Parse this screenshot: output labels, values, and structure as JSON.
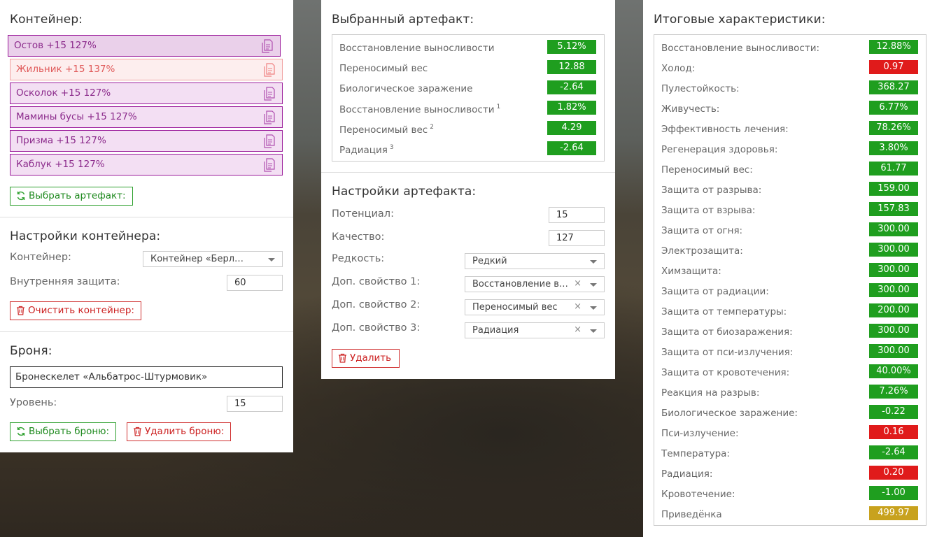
{
  "container_panel": {
    "title": "Контейнер:",
    "slots": [
      "Остов +15 127%",
      "Жильник +15 137%",
      "Осколок +15 127%",
      "Мамины бусы +15 127%",
      "Призма +15 127%",
      "Каблук +15 127%"
    ],
    "select_artifact_label": "Выбрать артефакт:",
    "settings_title": "Настройки контейнера:",
    "container_label": "Контейнер:",
    "container_value": "Контейнер «Берлога…",
    "inner_protection_label": "Внутренняя защита:",
    "inner_protection_value": "60",
    "clear_label": "Очистить контейнер:",
    "armor_title": "Броня:",
    "armor_value": "Бронескелет «Альбатрос-Штурмовик»",
    "level_label": "Уровень:",
    "level_value": "15",
    "select_armor_label": "Выбрать броню:",
    "delete_armor_label": "Удалить броню:"
  },
  "artifact_panel": {
    "title": "Выбранный артефакт:",
    "stats": [
      {
        "name": "Восстановление выносливости",
        "sup": "",
        "value": "5.12%",
        "color": "#1f9e1f"
      },
      {
        "name": "Переносимый вес",
        "sup": "",
        "value": "12.88",
        "color": "#1f9e1f"
      },
      {
        "name": "Биологическое заражение",
        "sup": "",
        "value": "-2.64",
        "color": "#1f9e1f"
      },
      {
        "name": "Восстановление выносливости",
        "sup": "1",
        "value": "1.82%",
        "color": "#1f9e1f"
      },
      {
        "name": "Переносимый вес",
        "sup": "2",
        "value": "4.29",
        "color": "#1f9e1f"
      },
      {
        "name": "Радиация",
        "sup": "3",
        "value": "-2.64",
        "color": "#1f9e1f"
      }
    ],
    "settings_title": "Настройки артефакта:",
    "potential_label": "Потенциал:",
    "potential_value": "15",
    "quality_label": "Качество:",
    "quality_value": "127",
    "rarity_label": "Редкость:",
    "rarity_value": "Редкий",
    "prop1_label": "Доп. свойство 1:",
    "prop1_value": "Восстановление в…",
    "prop2_label": "Доп. свойство 2:",
    "prop2_value": "Переносимый вес",
    "prop3_label": "Доп. свойство 3:",
    "prop3_value": "Радиация",
    "delete_label": "Удалить"
  },
  "totals_panel": {
    "title": "Итоговые характеристики:",
    "stats": [
      {
        "name": "Восстановление выносливости:",
        "value": "12.88%",
        "color": "#1f9e1f"
      },
      {
        "name": "Холод:",
        "value": "0.97",
        "color": "#e01b1b"
      },
      {
        "name": "Пулестойкость:",
        "value": "368.27",
        "color": "#1f9e1f"
      },
      {
        "name": "Живучесть:",
        "value": "6.77%",
        "color": "#1f9e1f"
      },
      {
        "name": "Эффективность лечения:",
        "value": "78.26%",
        "color": "#1f9e1f"
      },
      {
        "name": "Регенерация здоровья:",
        "value": "3.80%",
        "color": "#1f9e1f"
      },
      {
        "name": "Переносимый вес:",
        "value": "61.77",
        "color": "#1f9e1f"
      },
      {
        "name": "Защита от разрыва:",
        "value": "159.00",
        "color": "#1f9e1f"
      },
      {
        "name": "Защита от взрыва:",
        "value": "157.83",
        "color": "#1f9e1f"
      },
      {
        "name": "Защита от огня:",
        "value": "300.00",
        "color": "#1f9e1f"
      },
      {
        "name": "Электрозащита:",
        "value": "300.00",
        "color": "#1f9e1f"
      },
      {
        "name": "Химзащита:",
        "value": "300.00",
        "color": "#1f9e1f"
      },
      {
        "name": "Защита от радиации:",
        "value": "300.00",
        "color": "#1f9e1f"
      },
      {
        "name": "Защита от температуры:",
        "value": "200.00",
        "color": "#1f9e1f"
      },
      {
        "name": "Защита от биозаражения:",
        "value": "300.00",
        "color": "#1f9e1f"
      },
      {
        "name": "Защита от пси-излучения:",
        "value": "300.00",
        "color": "#1f9e1f"
      },
      {
        "name": "Защита от кровотечения:",
        "value": "40.00%",
        "color": "#1f9e1f"
      },
      {
        "name": "Реакция на разрыв:",
        "value": "7.26%",
        "color": "#1f9e1f"
      },
      {
        "name": "Биологическое заражение:",
        "value": "-0.22",
        "color": "#1f9e1f"
      },
      {
        "name": "Пси-излучение:",
        "value": "0.16",
        "color": "#e01b1b"
      },
      {
        "name": "Температура:",
        "value": "-2.64",
        "color": "#1f9e1f"
      },
      {
        "name": "Радиация:",
        "value": "0.20",
        "color": "#e01b1b"
      },
      {
        "name": "Кровотечение:",
        "value": "-1.00",
        "color": "#1f9e1f"
      },
      {
        "name": "Приведёнка",
        "value": "499.97",
        "color": "#c8a21e"
      }
    ]
  }
}
